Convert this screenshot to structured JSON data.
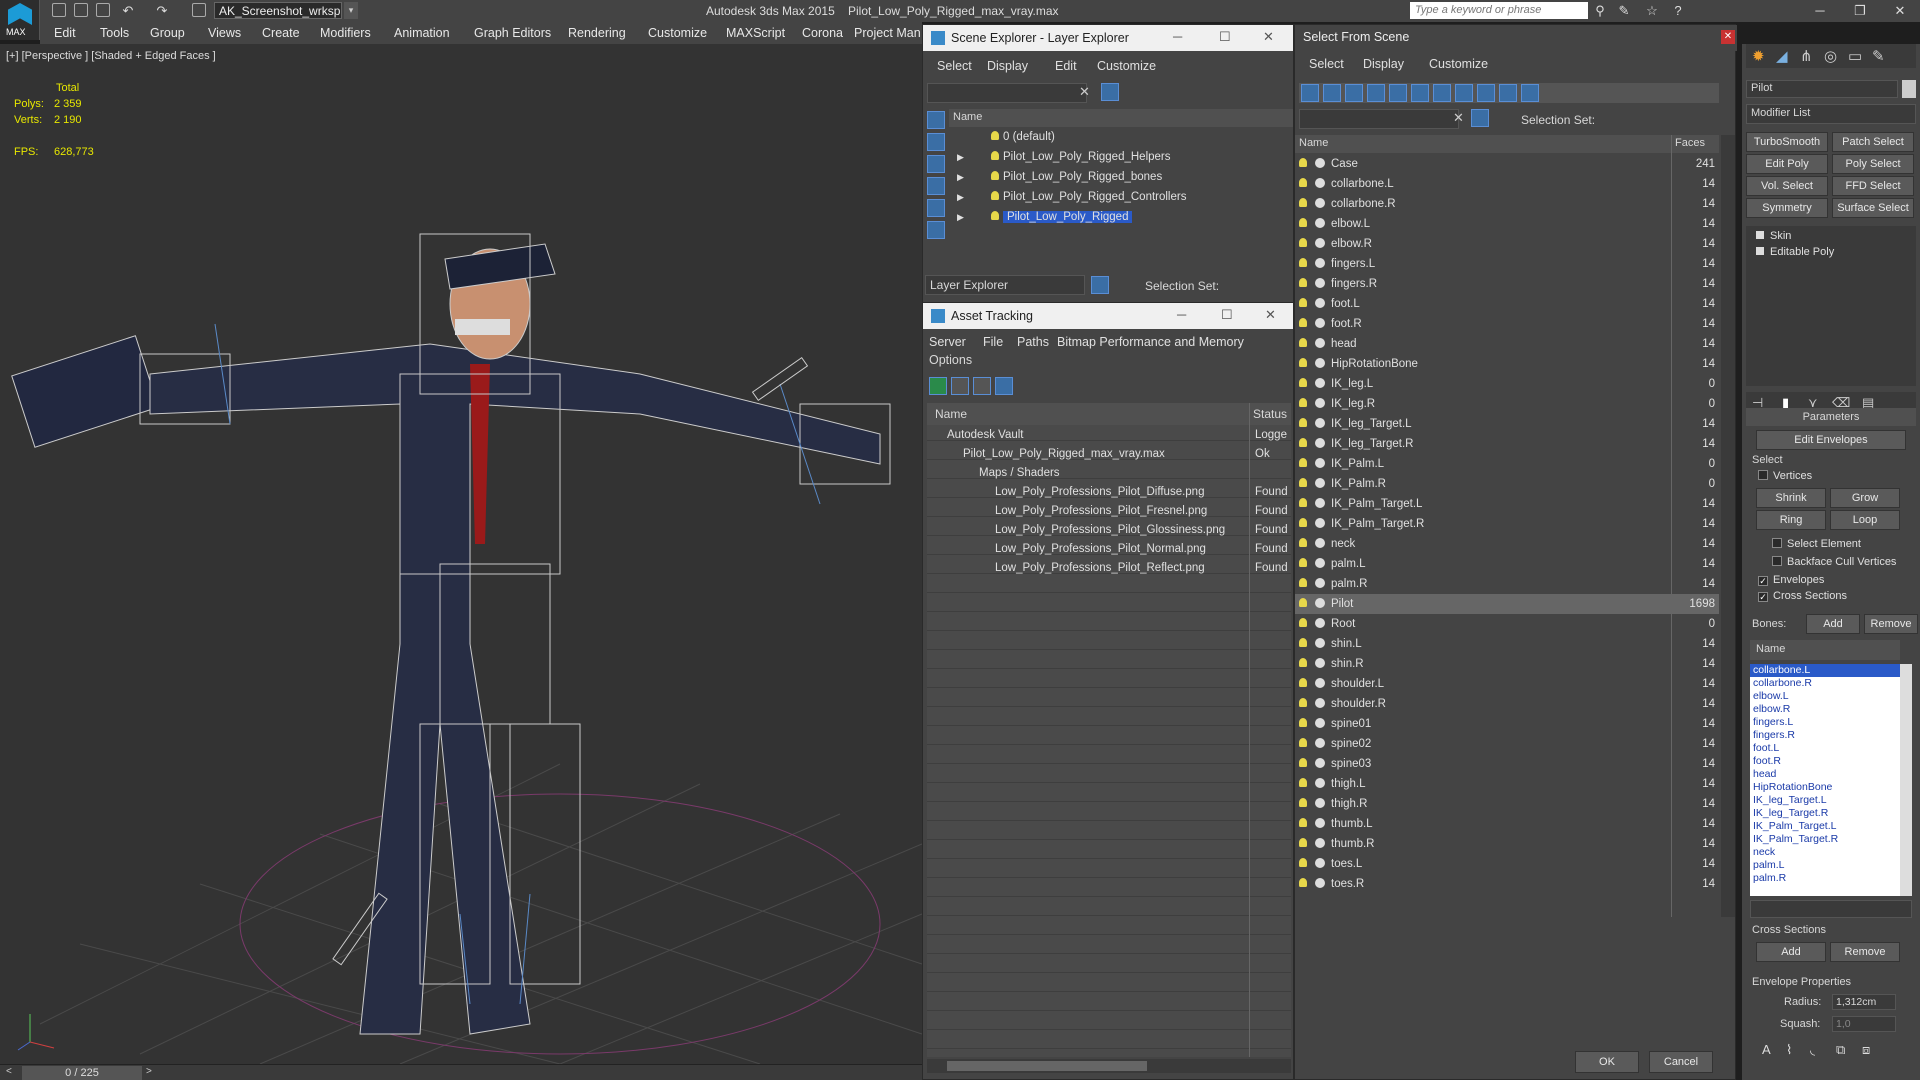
{
  "titlebar": {
    "workspace": "AK_Screenshot_wrksp",
    "app_title": "Autodesk 3ds Max  2015",
    "file_title": "Pilot_Low_Poly_Rigged_max_vray.max",
    "search_placeholder": "Type a keyword or phrase",
    "logo_text": "MAX"
  },
  "menubar": [
    "Edit",
    "Tools",
    "Group",
    "Views",
    "Create",
    "Modifiers",
    "Animation",
    "Graph Editors",
    "Rendering",
    "Customize",
    "MAXScript",
    "Corona",
    "Project Man"
  ],
  "viewport": {
    "label": "[+] [Perspective ] [Shaded + Edged Faces ]",
    "total_label": "Total",
    "polys_label": "Polys:",
    "polys": "2 359",
    "verts_label": "Verts:",
    "verts": "2 190",
    "fps_label": "FPS:",
    "fps": "628,773",
    "frame": "0 / 225"
  },
  "scene_explorer": {
    "title": "Scene Explorer - Layer Explorer",
    "menu": [
      "Select",
      "Display",
      "Edit",
      "Customize"
    ],
    "col_name": "Name",
    "layers": [
      {
        "name": "0 (default)"
      },
      {
        "name": "Pilot_Low_Poly_Rigged_Helpers"
      },
      {
        "name": "Pilot_Low_Poly_Rigged_bones"
      },
      {
        "name": "Pilot_Low_Poly_Rigged_Controllers"
      },
      {
        "name": "Pilot_Low_Poly_Rigged"
      }
    ],
    "footer_dropdown": "Layer Explorer",
    "selection_set": "Selection Set:"
  },
  "asset_tracking": {
    "title": "Asset Tracking",
    "menu": [
      "Server",
      "File",
      "Paths",
      "Bitmap Performance and Memory"
    ],
    "menu2": "Options",
    "col_name": "Name",
    "col_status": "Status",
    "rows": [
      {
        "name": "Autodesk Vault",
        "status": "Logge"
      },
      {
        "name": "Pilot_Low_Poly_Rigged_max_vray.max",
        "status": "Ok"
      },
      {
        "name": "Maps / Shaders",
        "status": ""
      },
      {
        "name": "Low_Poly_Professions_Pilot_Diffuse.png",
        "status": "Found"
      },
      {
        "name": "Low_Poly_Professions_Pilot_Fresnel.png",
        "status": "Found"
      },
      {
        "name": "Low_Poly_Professions_Pilot_Glossiness.png",
        "status": "Found"
      },
      {
        "name": "Low_Poly_Professions_Pilot_Normal.png",
        "status": "Found"
      },
      {
        "name": "Low_Poly_Professions_Pilot_Reflect.png",
        "status": "Found"
      }
    ]
  },
  "select_from_scene": {
    "title": "Select From Scene",
    "menu": [
      "Select",
      "Display",
      "Customize"
    ],
    "selection_set": "Selection Set:",
    "col_name": "Name",
    "col_faces": "Faces",
    "ok": "OK",
    "cancel": "Cancel",
    "objects": [
      [
        "Case",
        "241"
      ],
      [
        "collarbone.L",
        "14"
      ],
      [
        "collarbone.R",
        "14"
      ],
      [
        "elbow.L",
        "14"
      ],
      [
        "elbow.R",
        "14"
      ],
      [
        "fingers.L",
        "14"
      ],
      [
        "fingers.R",
        "14"
      ],
      [
        "foot.L",
        "14"
      ],
      [
        "foot.R",
        "14"
      ],
      [
        "head",
        "14"
      ],
      [
        "HipRotationBone",
        "14"
      ],
      [
        "IK_leg.L",
        "0"
      ],
      [
        "IK_leg.R",
        "0"
      ],
      [
        "IK_leg_Target.L",
        "14"
      ],
      [
        "IK_leg_Target.R",
        "14"
      ],
      [
        "IK_Palm.L",
        "0"
      ],
      [
        "IK_Palm.R",
        "0"
      ],
      [
        "IK_Palm_Target.L",
        "14"
      ],
      [
        "IK_Palm_Target.R",
        "14"
      ],
      [
        "neck",
        "14"
      ],
      [
        "palm.L",
        "14"
      ],
      [
        "palm.R",
        "14"
      ],
      [
        "Pilot",
        "1698"
      ],
      [
        "Root",
        "0"
      ],
      [
        "shin.L",
        "14"
      ],
      [
        "shin.R",
        "14"
      ],
      [
        "shoulder.L",
        "14"
      ],
      [
        "shoulder.R",
        "14"
      ],
      [
        "spine01",
        "14"
      ],
      [
        "spine02",
        "14"
      ],
      [
        "spine03",
        "14"
      ],
      [
        "thigh.L",
        "14"
      ],
      [
        "thigh.R",
        "14"
      ],
      [
        "thumb.L",
        "14"
      ],
      [
        "thumb.R",
        "14"
      ],
      [
        "toes.L",
        "14"
      ],
      [
        "toes.R",
        "14"
      ]
    ]
  },
  "command_panel": {
    "object_name": "Pilot",
    "modifier_list": "Modifier List",
    "buttons": [
      "TurboSmooth",
      "Patch Select",
      "Edit Poly",
      "Poly Select",
      "Vol. Select",
      "FFD Select",
      "Symmetry",
      "Surface Select"
    ],
    "stack": [
      "Skin",
      "Editable Poly"
    ],
    "parameters": "Parameters",
    "edit_envelopes": "Edit Envelopes",
    "select_label": "Select",
    "vertices": "Vertices",
    "shrink": "Shrink",
    "grow": "Grow",
    "ring": "Ring",
    "loop": "Loop",
    "select_element": "Select Element",
    "backface": "Backface Cull Vertices",
    "envelopes": "Envelopes",
    "cross_sections": "Cross Sections",
    "bones_label": "Bones:",
    "add": "Add",
    "remove": "Remove",
    "name_col": "Name",
    "bones": [
      "collarbone.L",
      "collarbone.R",
      "elbow.L",
      "elbow.R",
      "fingers.L",
      "fingers.R",
      "foot.L",
      "foot.R",
      "head",
      "HipRotationBone",
      "IK_leg_Target.L",
      "IK_leg_Target.R",
      "IK_Palm_Target.L",
      "IK_Palm_Target.R",
      "neck",
      "palm.L",
      "palm.R"
    ],
    "cross_sections_group": "Cross Sections",
    "cs_add": "Add",
    "cs_remove": "Remove",
    "envelope_props": "Envelope Properties",
    "radius_label": "Radius:",
    "radius": "1,312cm",
    "squash_label": "Squash:",
    "squash": "1,0"
  }
}
